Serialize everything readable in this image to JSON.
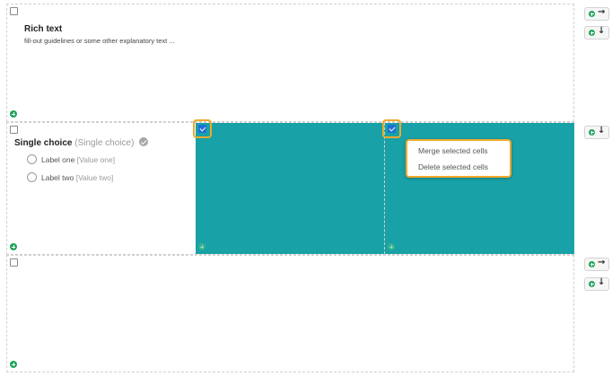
{
  "rows": {
    "rich_text": {
      "title": "Rich text",
      "subtitle": "fill-out guidelines or some other explanatory text ..."
    },
    "single_choice": {
      "title": "Single choice",
      "type_label": "(Single choice)",
      "options": [
        {
          "label": "Label one",
          "value": "[Value one]"
        },
        {
          "label": "Label two",
          "value": "[Value two]"
        }
      ]
    }
  },
  "context_menu": {
    "items": [
      "Merge selected cells",
      "Delete selected cells"
    ]
  },
  "side_buttons": {
    "add_right_arrow": "→",
    "add_below_arrow": "↓"
  },
  "colors": {
    "selected_cell": "#18a1a6",
    "highlight": "#f0a92e",
    "add_green": "#21a45a",
    "checkbox_checked": "#1f6fd6"
  }
}
